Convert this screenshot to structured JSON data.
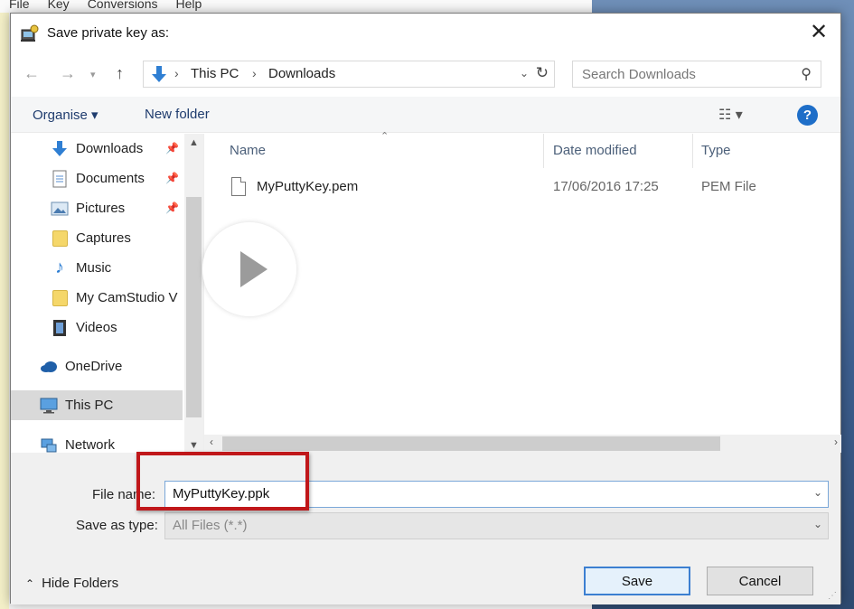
{
  "parent_window": {
    "menu": [
      "File",
      "Key",
      "Conversions",
      "Help"
    ]
  },
  "dialog": {
    "title": "Save private key as:",
    "close_glyph": "✕"
  },
  "address_bar": {
    "segments": [
      "This PC",
      "Downloads"
    ]
  },
  "search": {
    "placeholder": "Search Downloads"
  },
  "toolbar": {
    "organise_label": "Organise ▾",
    "new_folder_label": "New folder",
    "help_glyph": "?"
  },
  "nav_pane": {
    "items": [
      {
        "label": "Downloads",
        "icon": "download-arrow-icon",
        "pinned": true
      },
      {
        "label": "Documents",
        "icon": "document-icon",
        "pinned": true
      },
      {
        "label": "Pictures",
        "icon": "pictures-icon",
        "pinned": true
      },
      {
        "label": "Captures",
        "icon": "folder-icon",
        "pinned": false
      },
      {
        "label": "Music",
        "icon": "music-note-icon",
        "pinned": false
      },
      {
        "label": "My CamStudio V",
        "icon": "folder-icon",
        "pinned": false
      },
      {
        "label": "Videos",
        "icon": "film-icon",
        "pinned": false
      },
      {
        "label": "OneDrive",
        "icon": "cloud-icon",
        "pinned": false
      },
      {
        "label": "This PC",
        "icon": "computer-icon",
        "pinned": false,
        "selected": true
      },
      {
        "label": "Network",
        "icon": "network-icon",
        "pinned": false
      }
    ]
  },
  "file_list": {
    "columns": [
      "Name",
      "Date modified",
      "Type"
    ],
    "files": [
      {
        "name": "MyPuttyKey.pem",
        "date": "17/06/2016 17:25",
        "type": "PEM File"
      }
    ]
  },
  "form": {
    "file_name_label": "File name:",
    "file_name_value": "MyPuttyKey.ppk",
    "save_as_type_label": "Save as type:",
    "save_as_type_value": "All Files (*.*)",
    "hide_folders_label": "Hide Folders",
    "save_label": "Save",
    "cancel_label": "Cancel"
  },
  "colors": {
    "highlight": "#c0171a",
    "accent": "#1e6ec8"
  }
}
